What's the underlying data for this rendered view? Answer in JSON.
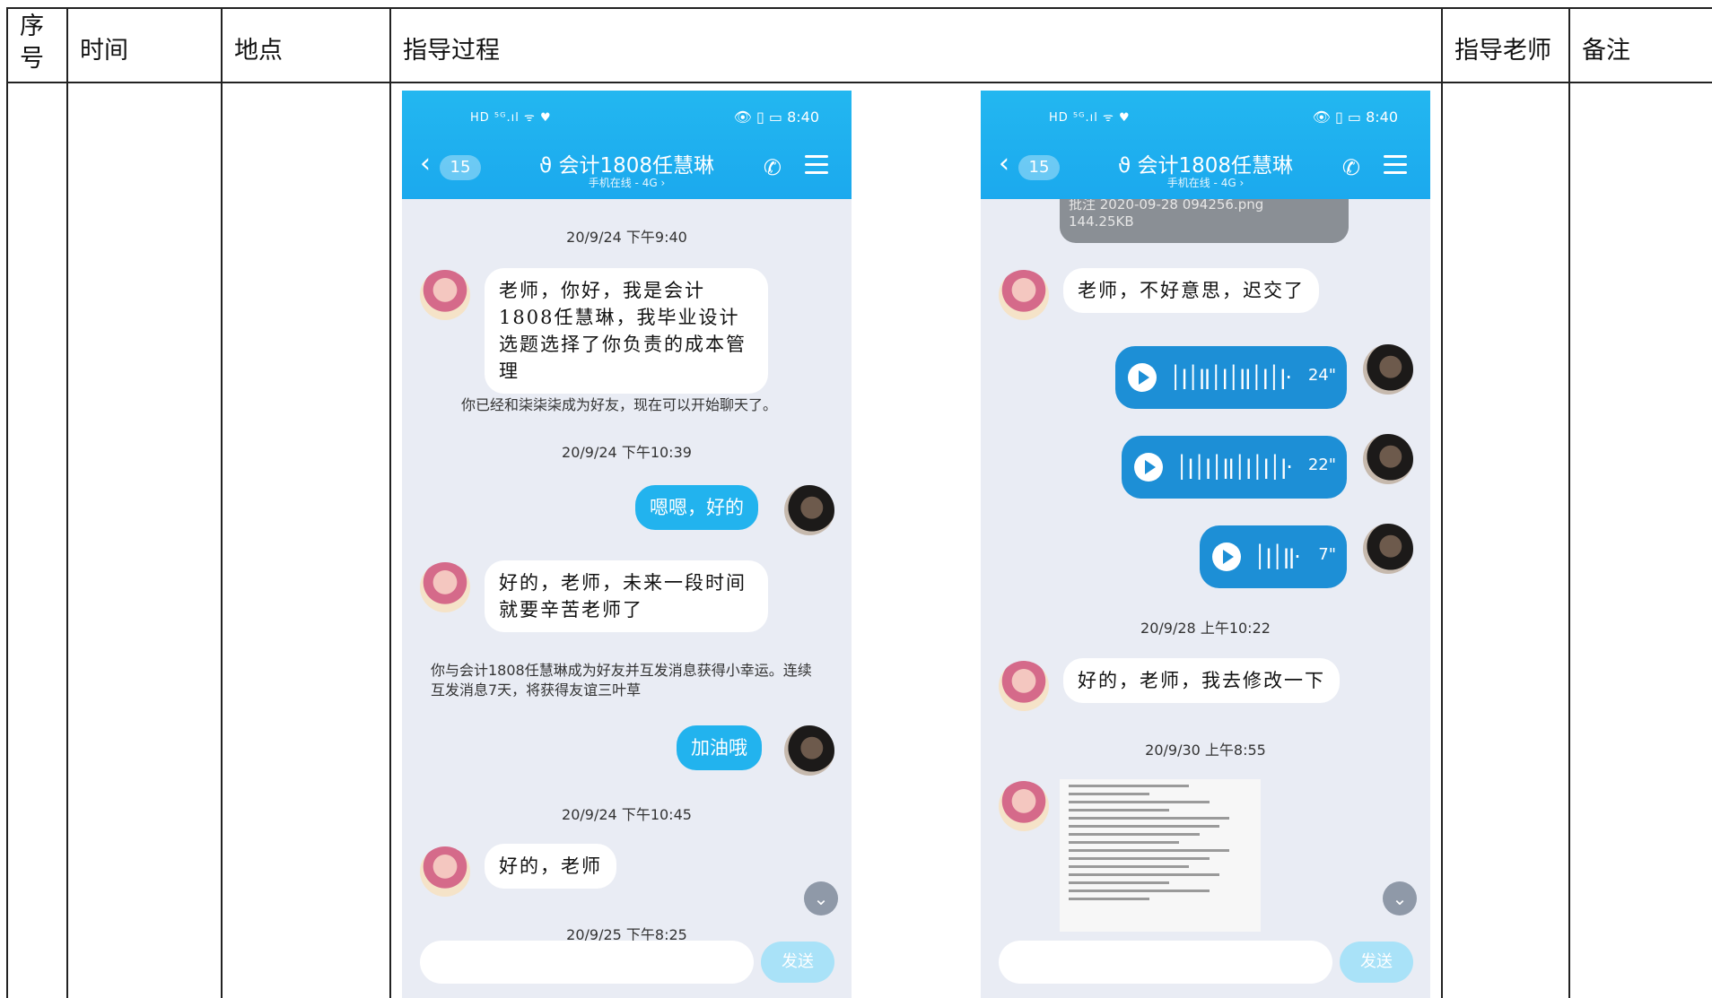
{
  "table": {
    "headers": [
      "序\n号",
      "时间",
      "地点",
      "指导过程",
      "指导老师",
      "备注"
    ]
  },
  "phone_left": {
    "status_time": "8:40",
    "badge": "15",
    "title": "会计1808任慧琳",
    "subtitle": "手机在线 - 4G",
    "send_label": "发送",
    "messages": [
      {
        "type": "time",
        "text": "20/9/24 下午9:40"
      },
      {
        "type": "in",
        "text": "老师，你好，我是会计1808任慧琳，我毕业设计选题选择了你负责的成本管理"
      },
      {
        "type": "system",
        "text": "你已经和柒柒柒成为好友，现在可以开始聊天了。"
      },
      {
        "type": "time",
        "text": "20/9/24 下午10:39"
      },
      {
        "type": "out",
        "text": "嗯嗯，好的"
      },
      {
        "type": "in",
        "text": "好的，老师，未来一段时间就要辛苦老师了"
      },
      {
        "type": "system",
        "text": "你与会计1808任慧琳成为好友并互发消息获得小幸运。连续互发消息7天，将获得友谊三叶草"
      },
      {
        "type": "out",
        "text": "加油哦"
      },
      {
        "type": "time",
        "text": "20/9/24 下午10:45"
      },
      {
        "type": "in",
        "text": "好的，老师"
      },
      {
        "type": "time",
        "text": "20/9/25 下午8:25"
      }
    ]
  },
  "phone_right": {
    "status_time": "8:40",
    "badge": "15",
    "title": "会计1808任慧琳",
    "subtitle": "手机在线 - 4G",
    "send_label": "发送",
    "top_file_name": "批注 2020-09-28 094256.png",
    "top_file_size": "144.25KB",
    "messages": [
      {
        "type": "in",
        "text": "老师，不好意思，迟交了"
      },
      {
        "type": "voice",
        "duration": "24\""
      },
      {
        "type": "voice",
        "duration": "22\""
      },
      {
        "type": "voice",
        "duration": "7\""
      },
      {
        "type": "time",
        "text": "20/9/28 上午10:22"
      },
      {
        "type": "in",
        "text": "好的，老师，我去修改一下"
      },
      {
        "type": "time",
        "text": "20/9/30 上午8:55"
      },
      {
        "type": "file",
        "text": "document image"
      }
    ]
  },
  "colors": {
    "header": "#1ba9ee",
    "chat_bg": "#e9ecf4",
    "voice": "#1d8fd6",
    "out_bubble": "#22b3ee"
  }
}
